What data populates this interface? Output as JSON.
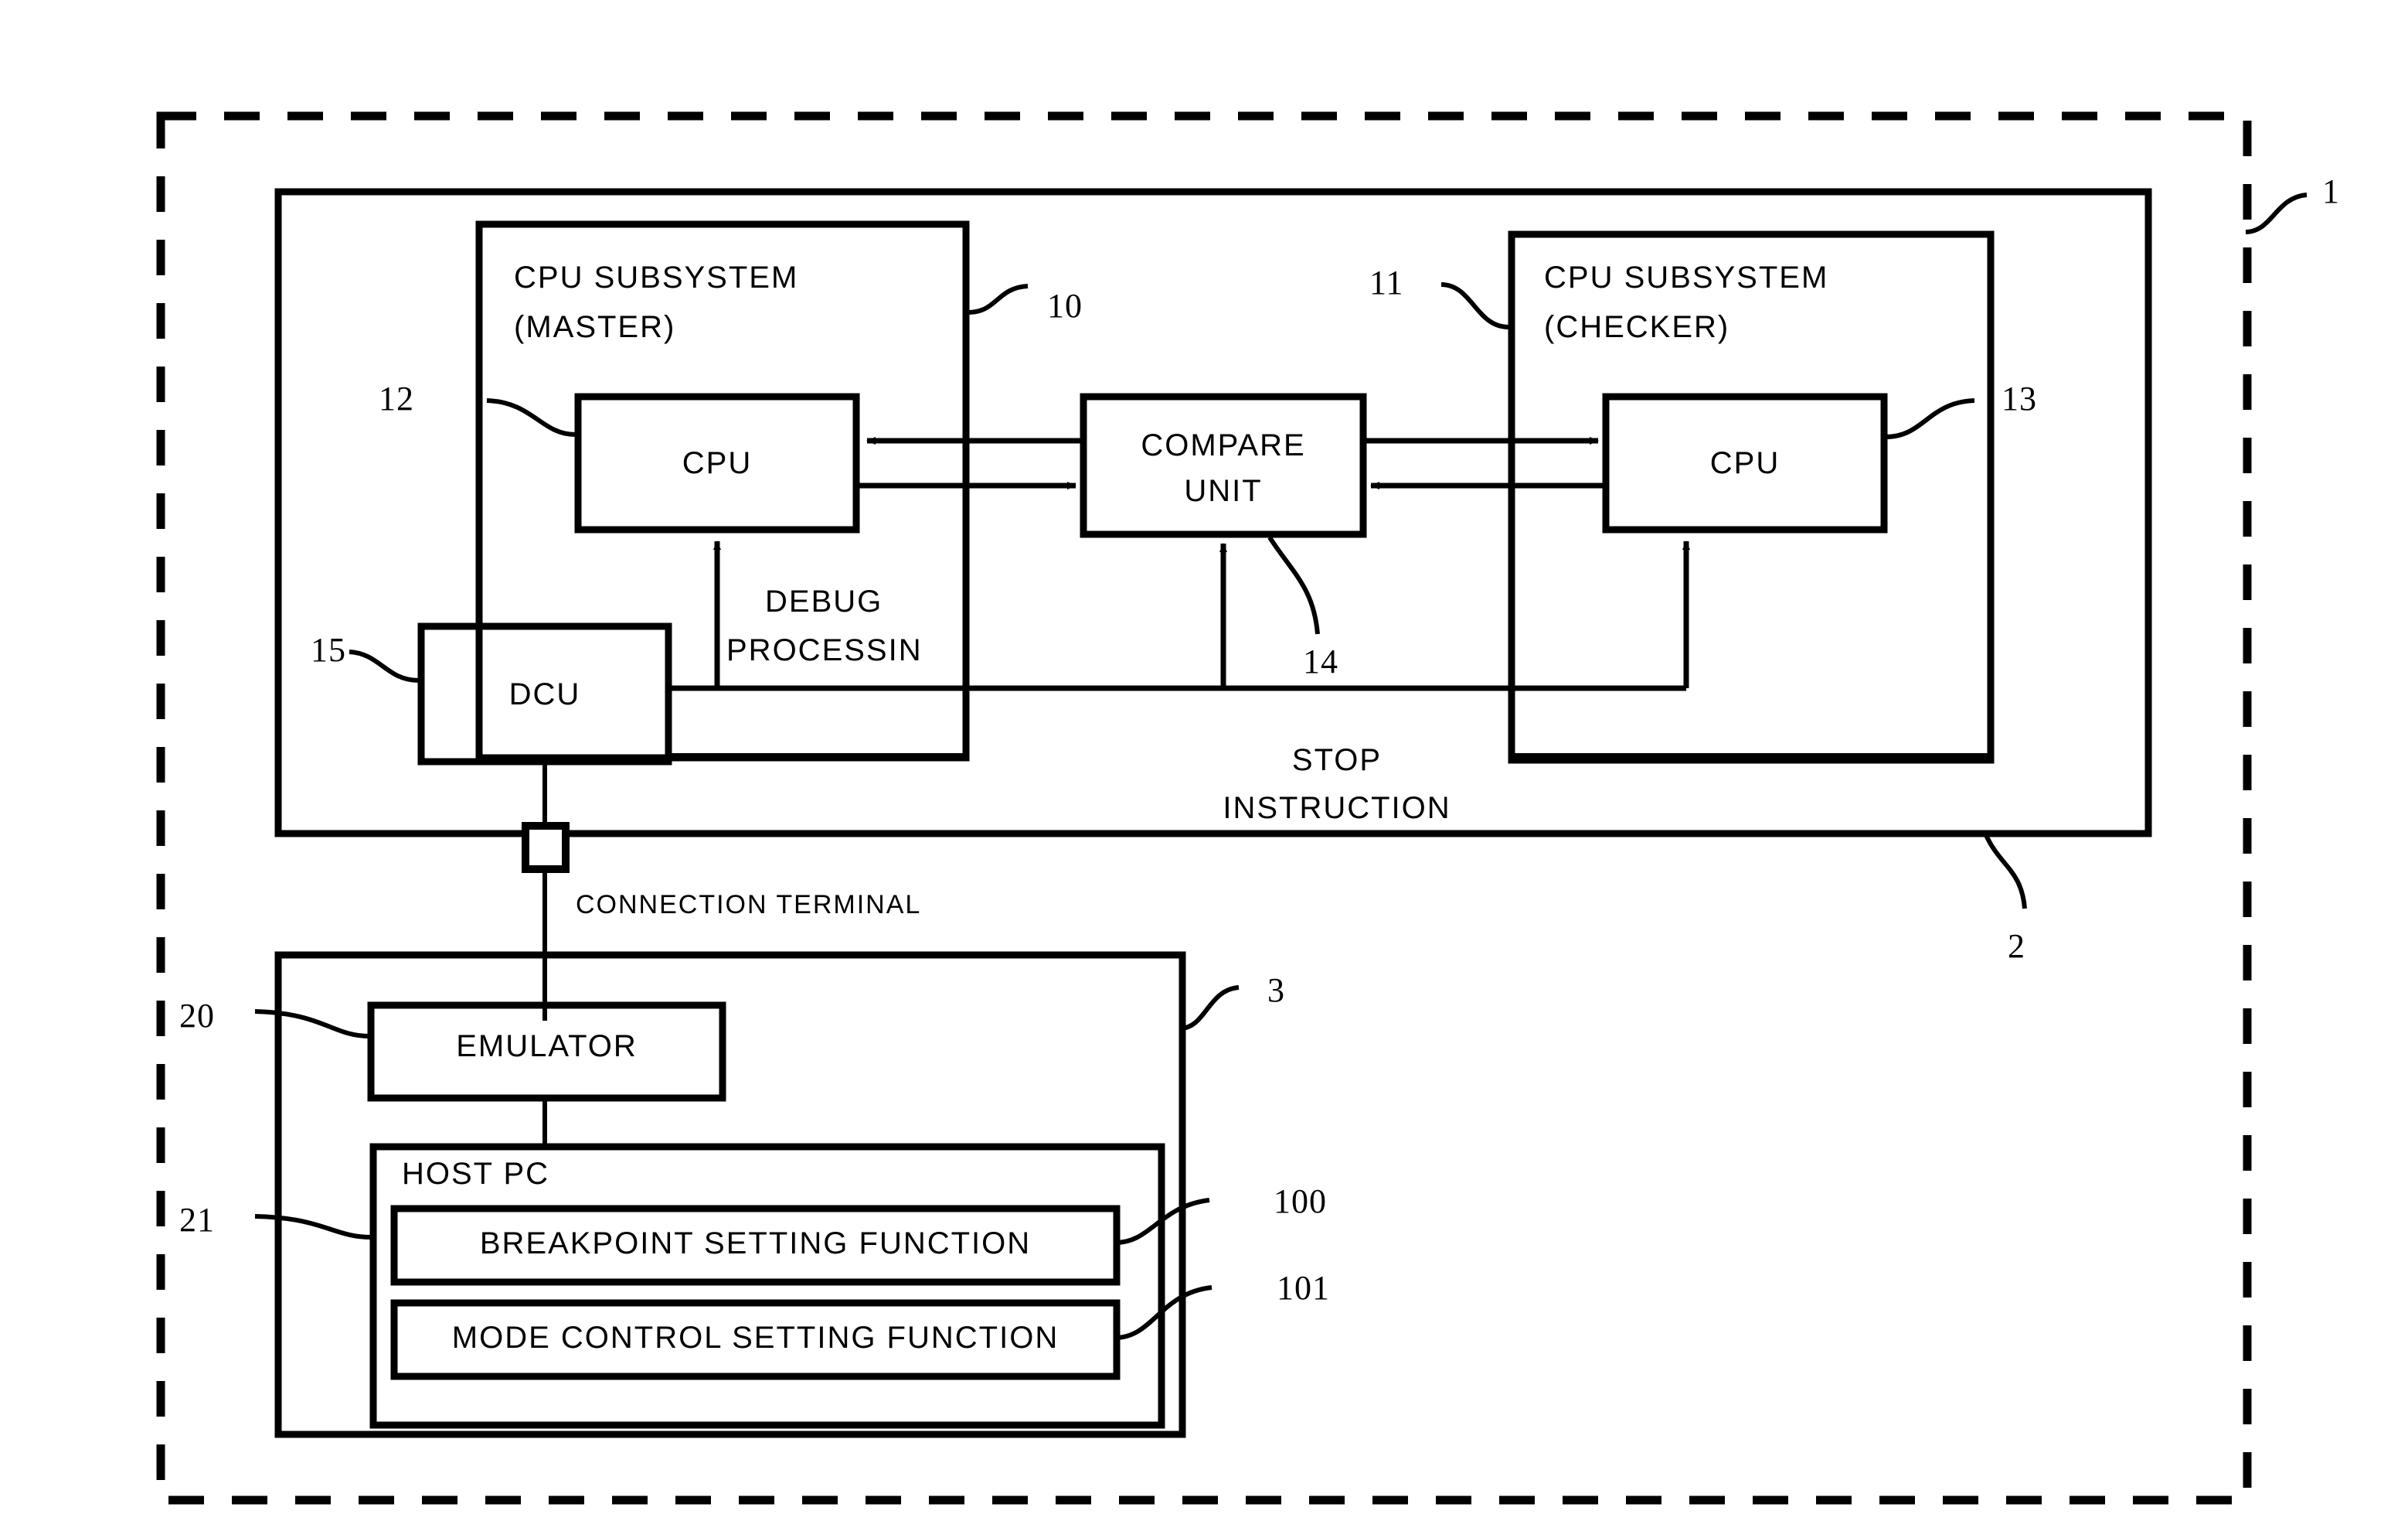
{
  "figure": {
    "type": "patent-block-diagram",
    "description": "Debug system block diagram with master/checker CPU subsystems, compare unit, DCU, emulator and host PC"
  },
  "outer": {
    "ref": "1"
  },
  "system_box": {
    "ref": "2"
  },
  "master_subsystem": {
    "title_line1": "CPU SUBSYSTEM",
    "title_line2": "(MASTER)",
    "ref": "10"
  },
  "checker_subsystem": {
    "title_line1": "CPU SUBSYSTEM",
    "title_line2": "(CHECKER)",
    "ref": "11"
  },
  "master_cpu": {
    "label": "CPU",
    "ref": "12"
  },
  "checker_cpu": {
    "label": "CPU",
    "ref": "13"
  },
  "compare_unit": {
    "label_line1": "COMPARE",
    "label_line2": "UNIT",
    "ref": "14"
  },
  "dcu": {
    "label": "DCU",
    "ref": "15"
  },
  "annotations": {
    "debug_processing_line1": "DEBUG",
    "debug_processing_line2": "PROCESSIN",
    "stop_instruction_line1": "STOP",
    "stop_instruction_line2": "INSTRUCTION",
    "connection_terminal": "CONNECTION TERMINAL"
  },
  "debug_tools_box": {
    "ref": "3"
  },
  "emulator": {
    "label": "EMULATOR",
    "ref": "20"
  },
  "host_pc": {
    "label": "HOST PC",
    "ref": "21"
  },
  "breakpoint_function": {
    "label": "BREAKPOINT SETTING FUNCTION",
    "ref": "100"
  },
  "mode_control_function": {
    "label": "MODE CONTROL SETTING FUNCTION",
    "ref": "101"
  },
  "colors": {
    "ink": "#000000",
    "paper": "#ffffff"
  }
}
